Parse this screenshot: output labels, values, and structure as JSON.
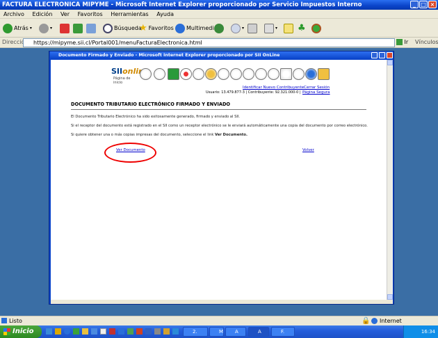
{
  "window": {
    "title": "FACTURA ELECTRONICA MIPYME - Microsoft Internet Explorer proporcionado por Servicio Impuestos Interno"
  },
  "menu": [
    "Archivo",
    "Edición",
    "Ver",
    "Favoritos",
    "Herramientas",
    "Ayuda"
  ],
  "toolbar": {
    "back": "Atrás",
    "search": "Búsqueda",
    "favorites": "Favoritos",
    "multimedia": "Multimedia"
  },
  "address": {
    "label": "Dirección",
    "url": "https://mipyme.sii.cl/Portal001/menuFacturaElectronica.html",
    "go": "Ir",
    "links": "Vínculos"
  },
  "popup": {
    "title": "Documento Firmado y Enviado - Microsoft Internet Explorer proporcionado por SII OnLine",
    "logo_main": "SII",
    "logo_accent": "online",
    "logo_sub": "Página de inicio",
    "link_identify": "Identificar Nuevo Contribuyente",
    "link_logout": "Cerrar Sesión",
    "link_secure": "Página Segura",
    "user_line": "Usuario: 13.479.877-3 | Contribuyente: 92.321.000-0 |",
    "heading": "DOCUMENTO TRIBUTARIO ELECTRÓNICO FIRMADO Y ENVIADO",
    "p1": "El Documento Tributario Electrónico ha sido exitosamente generado, firmado y enviado al SII.",
    "p2": "Si el receptor del documento está registrado en el SII como un receptor electrónico se le enviará automáticamente una copia del documento por correo electrónico.",
    "p3a": "Si quiere obtener una o más copias impresas del documento, seleccione el link ",
    "p3b": "Ver Documento.",
    "link_view": "Ver Documento",
    "link_back": "Volver"
  },
  "status": {
    "left": "Listo",
    "zone": "Internet"
  },
  "taskbar": {
    "start": "Inicio",
    "tasks": [
      "2.",
      "M",
      "A",
      "A",
      "F."
    ],
    "clock": "16:34"
  }
}
